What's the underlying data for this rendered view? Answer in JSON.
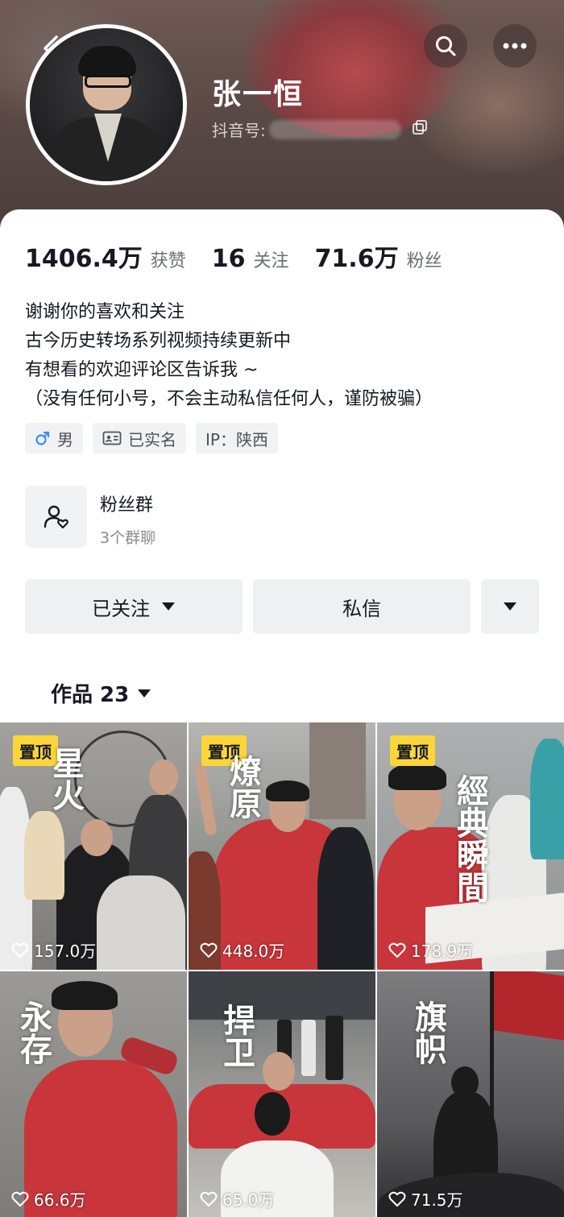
{
  "header": {
    "name": "张一恒",
    "douyin_id_label": "抖音号:",
    "icons": [
      "back-icon",
      "search-icon",
      "more-icon",
      "copy-icon"
    ]
  },
  "stats": [
    {
      "number": "1406.4万",
      "label": "获赞"
    },
    {
      "number": "16",
      "label": "关注"
    },
    {
      "number": "71.6万",
      "label": "粉丝"
    }
  ],
  "bio": [
    "谢谢你的喜欢和关注",
    "古今历史转场系列视频持续更新中",
    "有想看的欢迎评论区告诉我 ~",
    "（没有任何小号，不会主动私信任何人，谨防被骗）"
  ],
  "tags": {
    "gender": "男",
    "verified": "已实名",
    "ip": "IP：陕西"
  },
  "fan_group": {
    "title": "粉丝群",
    "subtitle": "3个群聊"
  },
  "actions": {
    "follow": "已关注",
    "message": "私信"
  },
  "works": {
    "label": "作品 23",
    "pinned_label": "置顶",
    "videos": [
      {
        "title": "星火",
        "likes": "157.0万",
        "pinned": true
      },
      {
        "title": "燎原",
        "likes": "448.0万",
        "pinned": true
      },
      {
        "title": "經典瞬間",
        "likes": "178.9万",
        "pinned": true
      },
      {
        "title": "永存",
        "likes": "66.6万",
        "pinned": false
      },
      {
        "title": "捍卫",
        "likes": "65.0万",
        "pinned": false
      },
      {
        "title": "旗帜",
        "likes": "71.5万",
        "pinned": false
      }
    ]
  },
  "colors": {
    "pin_badge": "#fcd639",
    "button_bg": "#eff0f2",
    "gender_blue": "#3d8af7",
    "red_hoodie": "#c8363c"
  }
}
